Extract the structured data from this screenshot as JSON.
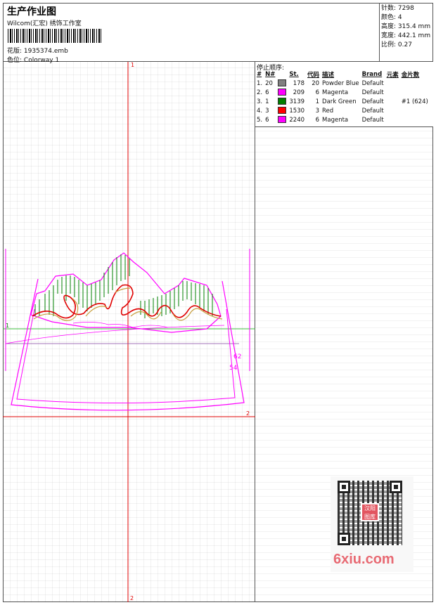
{
  "header": {
    "title": "生产作业图",
    "studio": "Wilcom(汇宏) 绣饰工作室",
    "design_label": "花版:",
    "design_file": "1935374.emb",
    "colorway_label": "色位:",
    "colorway": "Colorway 1"
  },
  "stats": {
    "stitches_label": "针数:",
    "stitches": "7298",
    "colors_label": "颜色:",
    "colors": "4",
    "height_label": "高度:",
    "height": "315.4 mm",
    "width_label": "宽度:",
    "width": "442.1 mm",
    "scale_label": "比例:",
    "scale": "0.27"
  },
  "stop_sequence": {
    "title": "停止顺序:",
    "headers": [
      "#",
      "N#",
      "St.",
      "代码",
      "描述",
      "Brand",
      "元素",
      "金片数"
    ],
    "rows": [
      {
        "idx": "1.",
        "n": "20",
        "color": "#808080",
        "st": "178",
        "code": "20",
        "desc": "Powder Blue",
        "brand": "Default",
        "elem": "",
        "sequins": ""
      },
      {
        "idx": "2.",
        "n": "6",
        "color": "#ff00ff",
        "st": "209",
        "code": "6",
        "desc": "Magenta",
        "brand": "Default",
        "elem": "",
        "sequins": ""
      },
      {
        "idx": "3.",
        "n": "1",
        "color": "#008000",
        "st": "3139",
        "code": "1",
        "desc": "Dark Green",
        "brand": "Default",
        "elem": "",
        "sequins": "#1 (624)"
      },
      {
        "idx": "4.",
        "n": "3",
        "color": "#ff0000",
        "st": "1530",
        "code": "3",
        "desc": "Red",
        "brand": "Default",
        "elem": "",
        "sequins": ""
      },
      {
        "idx": "5.",
        "n": "6",
        "color": "#ff00ff",
        "st": "2240",
        "code": "6",
        "desc": "Magenta",
        "brand": "Default",
        "elem": "",
        "sequins": ""
      }
    ]
  },
  "canvas": {
    "axis_top": "1",
    "axis_left": "1",
    "axis_right": "2",
    "axis_bottom": "2",
    "label_a": "62",
    "label_b": "54"
  },
  "watermark": {
    "brand": "6xiu.com",
    "logo_text": "汉阳\n图库"
  },
  "colors": {
    "magenta": "#ff00ff",
    "red": "#e00000",
    "green": "#008000",
    "axis_green": "#40c040",
    "tan": "#c8a040"
  }
}
